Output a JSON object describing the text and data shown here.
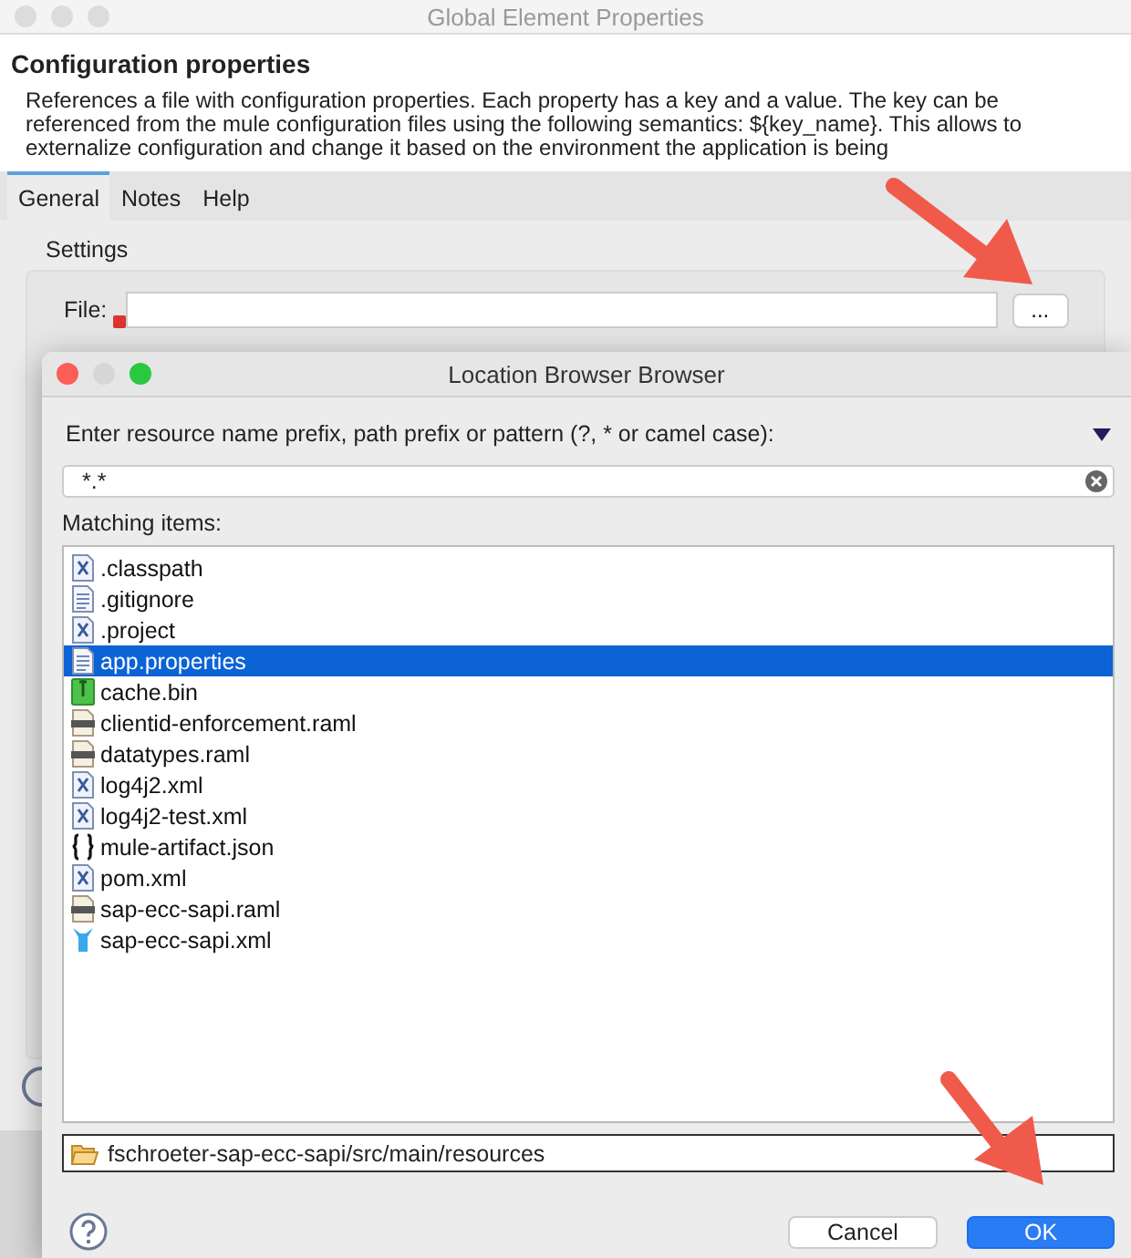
{
  "window": {
    "title": "Global Element Properties"
  },
  "header": {
    "title": "Configuration properties",
    "description": "References a file with configuration properties. Each property has a key and a value. The key can be referenced from the mule configuration files using the following semantics: ${key_name}. This allows to externalize configuration and change it based on the environment the application is being"
  },
  "tabs": [
    {
      "label": "General",
      "selected": true
    },
    {
      "label": "Notes",
      "selected": false
    },
    {
      "label": "Help",
      "selected": false
    }
  ],
  "settings": {
    "group_label": "Settings",
    "file_label": "File:",
    "file_error": true,
    "browse_button": "..."
  },
  "dialog": {
    "title": "Location Browser Browser",
    "prompt": "Enter resource name prefix, path prefix or pattern (?, * or camel case):",
    "filter": "*.*",
    "matching_label": "Matching items:",
    "items": [
      {
        "name": ".classpath",
        "kind": "xml",
        "selected": false
      },
      {
        "name": ".gitignore",
        "kind": "text",
        "selected": false
      },
      {
        "name": ".project",
        "kind": "xml",
        "selected": false
      },
      {
        "name": "app.properties",
        "kind": "text",
        "selected": true
      },
      {
        "name": "cache.bin",
        "kind": "binary",
        "selected": false
      },
      {
        "name": "clientid-enforcement.raml",
        "kind": "raml",
        "selected": false
      },
      {
        "name": "datatypes.raml",
        "kind": "raml",
        "selected": false
      },
      {
        "name": "log4j2.xml",
        "kind": "xml",
        "selected": false
      },
      {
        "name": "log4j2-test.xml",
        "kind": "xml",
        "selected": false
      },
      {
        "name": "mule-artifact.json",
        "kind": "json",
        "selected": false
      },
      {
        "name": "pom.xml",
        "kind": "xml",
        "selected": false
      },
      {
        "name": "sap-ecc-sapi.raml",
        "kind": "raml",
        "selected": false
      },
      {
        "name": "sap-ecc-sapi.xml",
        "kind": "mule",
        "selected": false
      }
    ],
    "location": "fschroeter-sap-ecc-sapi/src/main/resources",
    "buttons": [
      {
        "label": "Cancel",
        "kind": "default"
      },
      {
        "label": "OK",
        "kind": "primary"
      }
    ]
  }
}
